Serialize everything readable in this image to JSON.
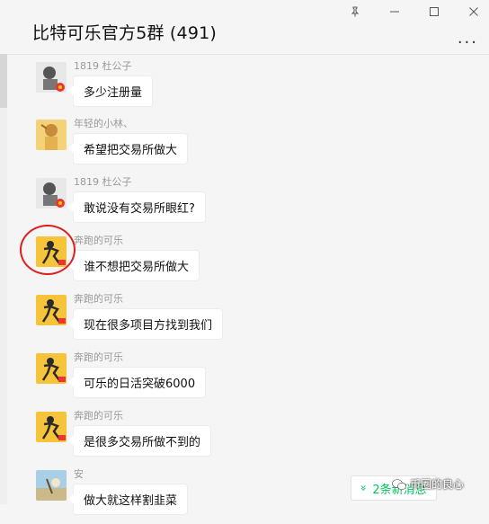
{
  "window": {
    "controls": [
      "pin-icon",
      "minimize-icon",
      "maximize-icon",
      "close-icon"
    ]
  },
  "header": {
    "title": "比特可乐官方5群 (491)",
    "more": "..."
  },
  "messages": [
    {
      "sender": "1819 杜公子",
      "text": "多少注册量",
      "avatar": "avatar-1819"
    },
    {
      "sender": "年轻的小林、",
      "text": "希望把交易所做大",
      "avatar": "avatar-xiaolin"
    },
    {
      "sender": "1819 杜公子",
      "text": "敢说没有交易所眼红?",
      "avatar": "avatar-1819"
    },
    {
      "sender": "奔跑的可乐",
      "text": "谁不想把交易所做大",
      "avatar": "avatar-kele"
    },
    {
      "sender": "奔跑的可乐",
      "text": "现在很多项目方找到我们",
      "avatar": "avatar-kele"
    },
    {
      "sender": "奔跑的可乐",
      "text": "可乐的日活突破6000",
      "avatar": "avatar-kele"
    },
    {
      "sender": "奔跑的可乐",
      "text": "是很多交易所做不到的",
      "avatar": "avatar-kele"
    },
    {
      "sender": "安",
      "text": "做大就这样割韭菜",
      "avatar": "avatar-an"
    }
  ],
  "new_messages": {
    "label": "2条新消息"
  },
  "watermark": {
    "text": "币圈的良心"
  },
  "colors": {
    "accent_green": "#07c160",
    "annotation_red": "#e01e1e"
  }
}
